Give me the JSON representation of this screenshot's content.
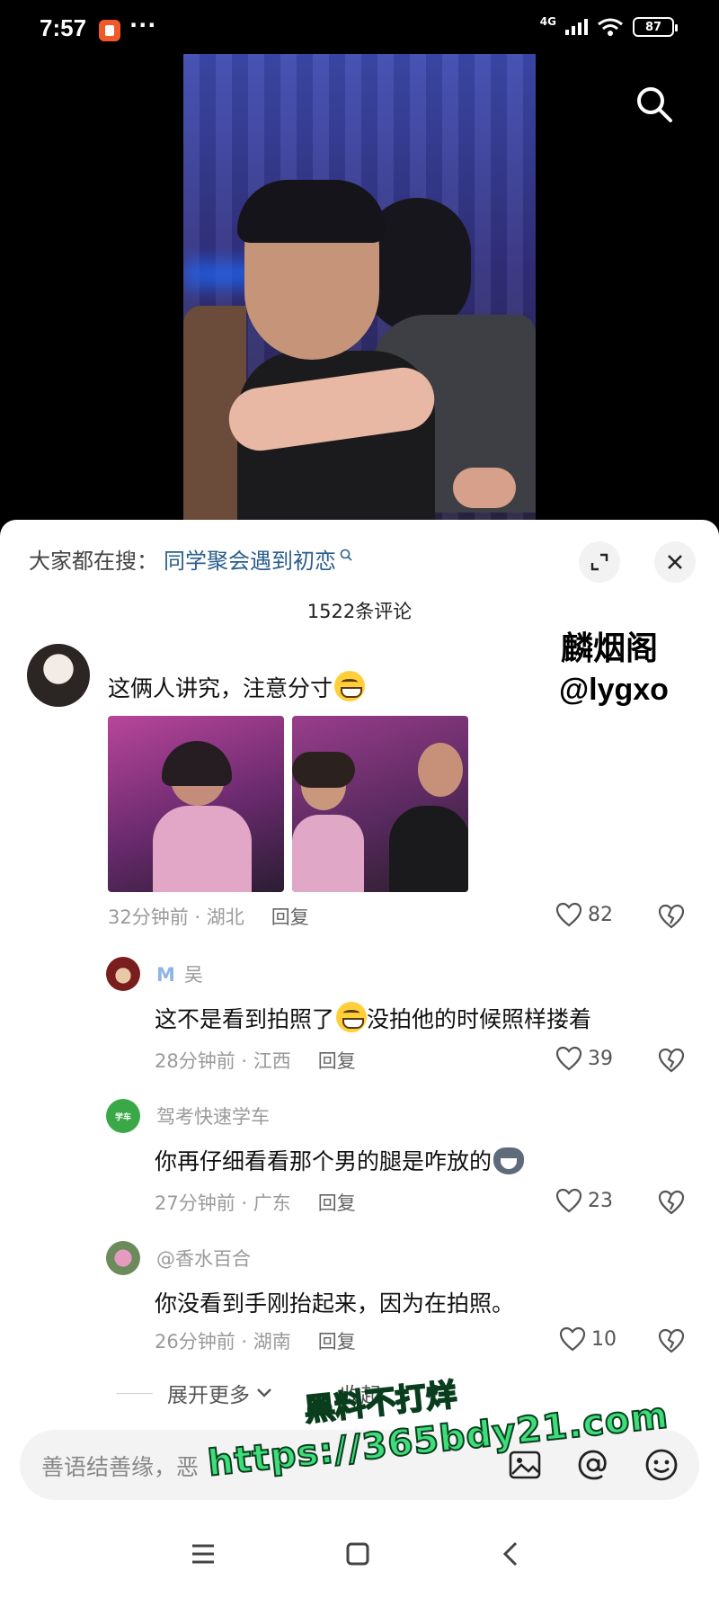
{
  "status_bar": {
    "time": "7:57",
    "more": "···",
    "network": "4G",
    "battery": "87"
  },
  "trending": {
    "prefix": "大家都在搜：",
    "query": "同学聚会遇到初恋"
  },
  "comments_header": {
    "count_label": "1522条评论"
  },
  "watermark": {
    "name": "麟烟阁",
    "handle": "@lygxo"
  },
  "comments": [
    {
      "text": "这俩人讲究，注意分寸",
      "time": "32分钟前",
      "region": "湖北",
      "reply_label": "回复",
      "likes": "82"
    },
    {
      "name": "吴",
      "text_before": "这不是看到拍照了",
      "text_after": "没拍他的时候照样搂着",
      "time": "28分钟前",
      "region": "江西",
      "reply_label": "回复",
      "likes": "39"
    },
    {
      "name": "驾考快速学车",
      "text": "你再仔细看看那个男的腿是咋放的",
      "time": "27分钟前",
      "region": "广东",
      "reply_label": "回复",
      "likes": "23"
    },
    {
      "name": "@香水百合",
      "text": "你没看到手刚抬起来，因为在拍照。",
      "time": "26分钟前",
      "region": "湖南",
      "reply_label": "回复",
      "likes": "10"
    }
  ],
  "thread_controls": {
    "expand_more": "展开更多",
    "collapse": "收起"
  },
  "promo_overlay": {
    "line1": "黑料不打烊",
    "line2": "https://365bdy21.com"
  },
  "input": {
    "placeholder": "善语结善缘，恶"
  },
  "icons": {
    "search": "search-icon",
    "expand": "expand-icon",
    "close": "close-icon",
    "heart": "heart-icon",
    "dislike": "broken-heart-icon",
    "image": "image-icon",
    "mention": "at-icon",
    "emoji": "emoji-icon",
    "menu": "menu-icon",
    "home": "home-icon",
    "back": "back-icon"
  },
  "colors": {
    "accent_link": "#2a5d8f",
    "promo_green": "#3fdc7a"
  }
}
